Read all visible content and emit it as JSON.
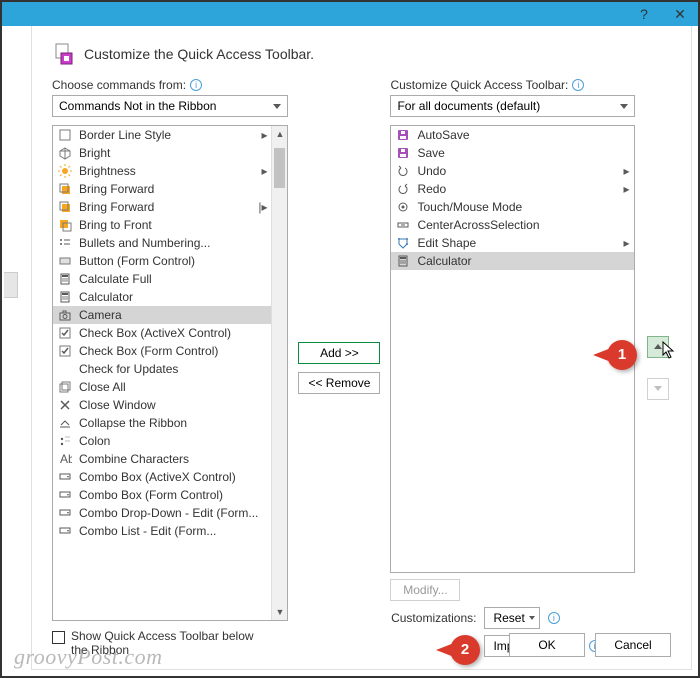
{
  "titlebar": {
    "help": "?",
    "close": "✕"
  },
  "header": {
    "title_text": "Customize the Quick Access Toolbar."
  },
  "left": {
    "label": "Choose commands from:",
    "select_value": "Commands Not in the Ribbon",
    "items": [
      {
        "icon": "border",
        "label": "Border Line Style",
        "sub": "▸"
      },
      {
        "icon": "cube",
        "label": "Bright"
      },
      {
        "icon": "sun",
        "label": "Brightness",
        "sub": "▸"
      },
      {
        "icon": "fwd",
        "label": "Bring Forward"
      },
      {
        "icon": "fwd",
        "label": "Bring Forward",
        "sub": "|▸"
      },
      {
        "icon": "front",
        "label": "Bring to Front"
      },
      {
        "icon": "bullets",
        "label": "Bullets and Numbering..."
      },
      {
        "icon": "btn",
        "label": "Button (Form Control)"
      },
      {
        "icon": "calc",
        "label": "Calculate Full"
      },
      {
        "icon": "calc",
        "label": "Calculator"
      },
      {
        "icon": "camera",
        "label": "Camera",
        "selected": true
      },
      {
        "icon": "check",
        "label": "Check Box (ActiveX Control)"
      },
      {
        "icon": "check",
        "label": "Check Box (Form Control)"
      },
      {
        "icon": "blank",
        "label": "Check for Updates"
      },
      {
        "icon": "closeall",
        "label": "Close All"
      },
      {
        "icon": "closewin",
        "label": "Close Window"
      },
      {
        "icon": "collapse",
        "label": "Collapse the Ribbon"
      },
      {
        "icon": "colon",
        "label": "Colon"
      },
      {
        "icon": "combine",
        "label": "Combine Characters"
      },
      {
        "icon": "combo",
        "label": "Combo Box (ActiveX Control)"
      },
      {
        "icon": "combo",
        "label": "Combo Box (Form Control)"
      },
      {
        "icon": "combo",
        "label": "Combo Drop-Down - Edit (Form..."
      },
      {
        "icon": "combo",
        "label": "Combo List - Edit (Form..."
      }
    ]
  },
  "mid": {
    "add": "Add >>",
    "remove": "<< Remove"
  },
  "right": {
    "label": "Customize Quick Access Toolbar:",
    "select_value": "For all documents (default)",
    "items": [
      {
        "icon": "save",
        "label": "AutoSave"
      },
      {
        "icon": "save",
        "label": "Save"
      },
      {
        "icon": "undo",
        "label": "Undo",
        "sub": "▸"
      },
      {
        "icon": "redo",
        "label": "Redo",
        "sub": "▸"
      },
      {
        "icon": "touch",
        "label": "Touch/Mouse Mode"
      },
      {
        "icon": "center",
        "label": "CenterAcrossSelection"
      },
      {
        "icon": "edit",
        "label": "Edit Shape",
        "sub": "▸"
      },
      {
        "icon": "calc",
        "label": "Calculator",
        "selected": true
      }
    ],
    "modify": "Modify...",
    "customizations_label": "Customizations:",
    "reset": "Reset",
    "import_export": "Import/Export"
  },
  "show_below": "Show Quick Access Toolbar below the Ribbon",
  "buttons": {
    "ok": "OK",
    "cancel": "Cancel"
  },
  "callouts": {
    "one": "1",
    "two": "2"
  },
  "watermark": "groovyPost.com"
}
